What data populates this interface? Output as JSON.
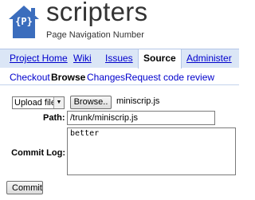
{
  "header": {
    "logo_text": "{P}",
    "project_name": "scripters",
    "project_summary": "Page Navigation Number"
  },
  "tabs": [
    {
      "label": "Project Home"
    },
    {
      "label": "Wiki"
    },
    {
      "label": "Issues"
    },
    {
      "label": "Source",
      "active": true
    },
    {
      "label": "Administer"
    }
  ],
  "subnav": [
    {
      "label": "Checkout"
    },
    {
      "label": "Browse",
      "current": true
    },
    {
      "label": "Changes"
    },
    {
      "label": "Request code review"
    }
  ],
  "form": {
    "upload_select": "Upload file",
    "browse_label": "Browse..",
    "file_name": "miniscrip.js",
    "path_label": "Path:",
    "path_value": "/trunk/miniscrip.js",
    "commit_log_label": "Commit Log:",
    "commit_log_value": "better",
    "commit_button": "Commit"
  },
  "colors": {
    "tab_bar": "#dbe6f6",
    "link": "#0000cc",
    "logo": "#3b6dbd"
  }
}
